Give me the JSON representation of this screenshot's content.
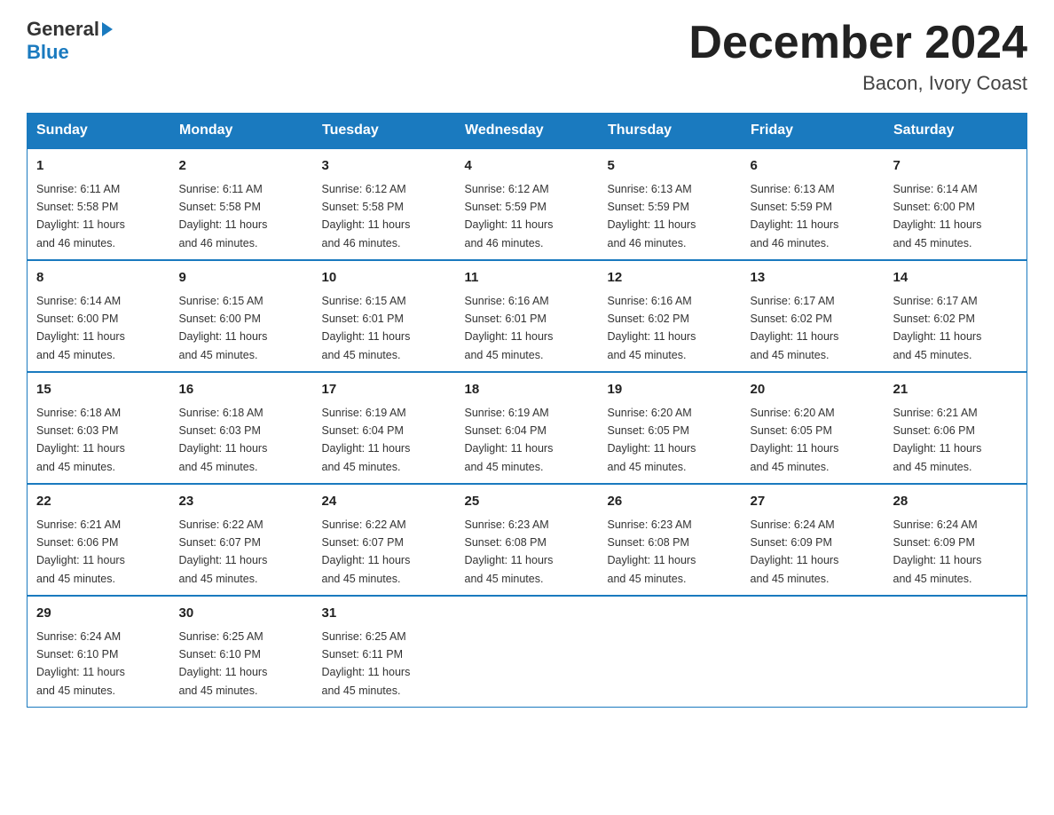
{
  "logo": {
    "general": "General",
    "blue": "Blue"
  },
  "title": "December 2024",
  "location": "Bacon, Ivory Coast",
  "headers": [
    "Sunday",
    "Monday",
    "Tuesday",
    "Wednesday",
    "Thursday",
    "Friday",
    "Saturday"
  ],
  "weeks": [
    [
      {
        "day": "1",
        "sunrise": "6:11 AM",
        "sunset": "5:58 PM",
        "daylight": "11 hours and 46 minutes."
      },
      {
        "day": "2",
        "sunrise": "6:11 AM",
        "sunset": "5:58 PM",
        "daylight": "11 hours and 46 minutes."
      },
      {
        "day": "3",
        "sunrise": "6:12 AM",
        "sunset": "5:58 PM",
        "daylight": "11 hours and 46 minutes."
      },
      {
        "day": "4",
        "sunrise": "6:12 AM",
        "sunset": "5:59 PM",
        "daylight": "11 hours and 46 minutes."
      },
      {
        "day": "5",
        "sunrise": "6:13 AM",
        "sunset": "5:59 PM",
        "daylight": "11 hours and 46 minutes."
      },
      {
        "day": "6",
        "sunrise": "6:13 AM",
        "sunset": "5:59 PM",
        "daylight": "11 hours and 46 minutes."
      },
      {
        "day": "7",
        "sunrise": "6:14 AM",
        "sunset": "6:00 PM",
        "daylight": "11 hours and 45 minutes."
      }
    ],
    [
      {
        "day": "8",
        "sunrise": "6:14 AM",
        "sunset": "6:00 PM",
        "daylight": "11 hours and 45 minutes."
      },
      {
        "day": "9",
        "sunrise": "6:15 AM",
        "sunset": "6:00 PM",
        "daylight": "11 hours and 45 minutes."
      },
      {
        "day": "10",
        "sunrise": "6:15 AM",
        "sunset": "6:01 PM",
        "daylight": "11 hours and 45 minutes."
      },
      {
        "day": "11",
        "sunrise": "6:16 AM",
        "sunset": "6:01 PM",
        "daylight": "11 hours and 45 minutes."
      },
      {
        "day": "12",
        "sunrise": "6:16 AM",
        "sunset": "6:02 PM",
        "daylight": "11 hours and 45 minutes."
      },
      {
        "day": "13",
        "sunrise": "6:17 AM",
        "sunset": "6:02 PM",
        "daylight": "11 hours and 45 minutes."
      },
      {
        "day": "14",
        "sunrise": "6:17 AM",
        "sunset": "6:02 PM",
        "daylight": "11 hours and 45 minutes."
      }
    ],
    [
      {
        "day": "15",
        "sunrise": "6:18 AM",
        "sunset": "6:03 PM",
        "daylight": "11 hours and 45 minutes."
      },
      {
        "day": "16",
        "sunrise": "6:18 AM",
        "sunset": "6:03 PM",
        "daylight": "11 hours and 45 minutes."
      },
      {
        "day": "17",
        "sunrise": "6:19 AM",
        "sunset": "6:04 PM",
        "daylight": "11 hours and 45 minutes."
      },
      {
        "day": "18",
        "sunrise": "6:19 AM",
        "sunset": "6:04 PM",
        "daylight": "11 hours and 45 minutes."
      },
      {
        "day": "19",
        "sunrise": "6:20 AM",
        "sunset": "6:05 PM",
        "daylight": "11 hours and 45 minutes."
      },
      {
        "day": "20",
        "sunrise": "6:20 AM",
        "sunset": "6:05 PM",
        "daylight": "11 hours and 45 minutes."
      },
      {
        "day": "21",
        "sunrise": "6:21 AM",
        "sunset": "6:06 PM",
        "daylight": "11 hours and 45 minutes."
      }
    ],
    [
      {
        "day": "22",
        "sunrise": "6:21 AM",
        "sunset": "6:06 PM",
        "daylight": "11 hours and 45 minutes."
      },
      {
        "day": "23",
        "sunrise": "6:22 AM",
        "sunset": "6:07 PM",
        "daylight": "11 hours and 45 minutes."
      },
      {
        "day": "24",
        "sunrise": "6:22 AM",
        "sunset": "6:07 PM",
        "daylight": "11 hours and 45 minutes."
      },
      {
        "day": "25",
        "sunrise": "6:23 AM",
        "sunset": "6:08 PM",
        "daylight": "11 hours and 45 minutes."
      },
      {
        "day": "26",
        "sunrise": "6:23 AM",
        "sunset": "6:08 PM",
        "daylight": "11 hours and 45 minutes."
      },
      {
        "day": "27",
        "sunrise": "6:24 AM",
        "sunset": "6:09 PM",
        "daylight": "11 hours and 45 minutes."
      },
      {
        "day": "28",
        "sunrise": "6:24 AM",
        "sunset": "6:09 PM",
        "daylight": "11 hours and 45 minutes."
      }
    ],
    [
      {
        "day": "29",
        "sunrise": "6:24 AM",
        "sunset": "6:10 PM",
        "daylight": "11 hours and 45 minutes."
      },
      {
        "day": "30",
        "sunrise": "6:25 AM",
        "sunset": "6:10 PM",
        "daylight": "11 hours and 45 minutes."
      },
      {
        "day": "31",
        "sunrise": "6:25 AM",
        "sunset": "6:11 PM",
        "daylight": "11 hours and 45 minutes."
      },
      null,
      null,
      null,
      null
    ]
  ],
  "labels": {
    "sunrise": "Sunrise:",
    "sunset": "Sunset:",
    "daylight": "Daylight:"
  }
}
